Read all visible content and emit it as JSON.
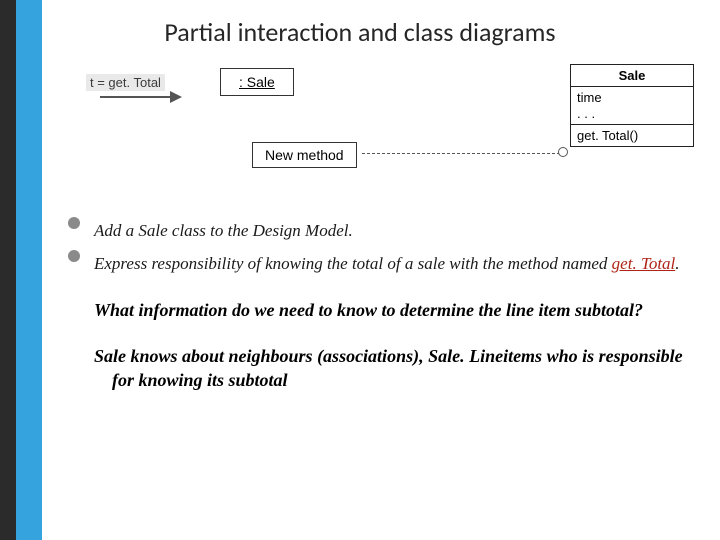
{
  "title": "Partial interaction and class diagrams",
  "diagram": {
    "call_label": "t = get. Total",
    "object_box": ": Sale",
    "note_box": "New method",
    "class_name": "Sale",
    "class_attrs": "time\n. . .",
    "class_ops": "get. Total()"
  },
  "bullets": [
    {
      "text": "Add a Sale class to the Design Model."
    },
    {
      "prefix": "Express responsibility of knowing the total of a sale with the method named ",
      "red": "get. Total",
      "suffix": "."
    }
  ],
  "paragraphs": [
    "What information do we need to know to determine the line item subtotal?",
    "Sale knows about neighbours (associations), Sale. Lineitems who is responsible for knowing its subtotal"
  ]
}
